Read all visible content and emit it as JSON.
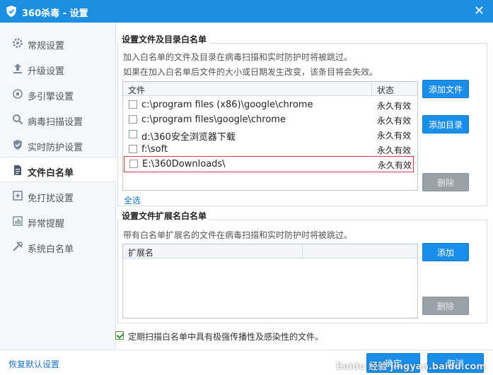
{
  "window": {
    "title": "360杀毒 - 设置",
    "close_glyph": "✕",
    "accent": "#1d8fe0"
  },
  "sidebar": {
    "items": [
      {
        "label": "常规设置",
        "icon": "gear-icon"
      },
      {
        "label": "升级设置",
        "icon": "upgrade-icon"
      },
      {
        "label": "多引擎设置",
        "icon": "engine-icon"
      },
      {
        "label": "病毒扫描设置",
        "icon": "search-icon"
      },
      {
        "label": "实时防护设置",
        "icon": "shield-icon"
      },
      {
        "label": "文件白名单",
        "icon": "document-icon",
        "active": true
      },
      {
        "label": "免打扰设置",
        "icon": "no-disturb-icon"
      },
      {
        "label": "异常提醒",
        "icon": "chart-icon"
      },
      {
        "label": "系统白名单",
        "icon": "tools-icon"
      }
    ]
  },
  "file_whitelist": {
    "title": "设置文件及目录白名单",
    "desc1": "加入白名单的文件及目录在病毒扫描和实时防护时将被跳过。",
    "desc2": "如果在加入白名单后文件的大小或日期发生改变，该条目将会失效。",
    "col_file": "文件",
    "col_status": "状态",
    "rows": [
      {
        "path": "c:\\program files (x86)\\google\\chrome",
        "status": "永久有效"
      },
      {
        "path": "c:\\program files\\google\\chrome",
        "status": "永久有效"
      },
      {
        "path": "d:\\360安全浏览器下载",
        "status": "永久有效"
      },
      {
        "path": "f:\\soft",
        "status": "永久有效"
      },
      {
        "path": "E:\\360Downloads\\",
        "status": "永久有效"
      }
    ],
    "add_file": "添加文件",
    "add_dir": "添加目录",
    "delete": "删除",
    "select_all": "全选"
  },
  "ext_whitelist": {
    "title": "设置文件扩展名白名单",
    "desc": "带有白名单扩展名的文件在病毒扫描和实时防护时将被跳过。",
    "col_ext": "扩展名",
    "add": "添加",
    "delete": "删除"
  },
  "periodic_scan": {
    "label": "定期扫描白名单中具有极强传播性及感染性的文件。",
    "checked": true
  },
  "footer": {
    "restore_defaults": "恢复默认设置",
    "ok": "确定",
    "cancel": "取消",
    "watermark": "Baidu 经验 jingyan.baidu.com"
  }
}
